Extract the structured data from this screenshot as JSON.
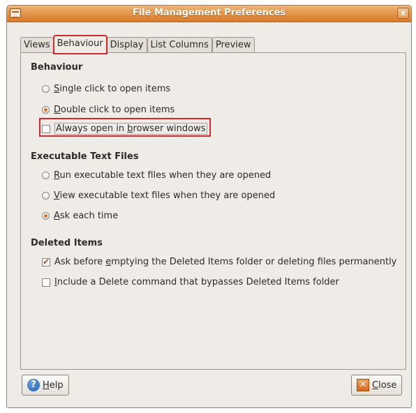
{
  "window": {
    "title": "File Management Preferences",
    "close_glyph": "x"
  },
  "tabs": [
    {
      "label": "Views"
    },
    {
      "label": "Behaviour"
    },
    {
      "label": "Display"
    },
    {
      "label": "List Columns"
    },
    {
      "label": "Preview"
    }
  ],
  "behaviour": {
    "section_title": "Behaviour",
    "single_click": {
      "mnemonic": "S",
      "rest": "ingle click to open items"
    },
    "double_click": {
      "mnemonic": "D",
      "rest": "ouble click to open items"
    },
    "always_browser": {
      "before": "Always open in ",
      "mnemonic": "b",
      "rest": "rowser windows"
    }
  },
  "executable": {
    "section_title": "Executable Text Files",
    "run": {
      "mnemonic": "R",
      "rest": "un executable text files when they are opened"
    },
    "view": {
      "mnemonic": "V",
      "rest": "iew executable text files when they are opened"
    },
    "ask": {
      "mnemonic": "A",
      "rest": "sk each time"
    }
  },
  "deleted": {
    "section_title": "Deleted Items",
    "ask_before": {
      "before": "Ask before ",
      "mnemonic": "e",
      "rest": "mptying the Deleted Items folder or deleting files permanently"
    },
    "include_delete": {
      "mnemonic": "I",
      "rest": "nclude a Delete command that bypasses Deleted Items folder"
    }
  },
  "buttons": {
    "help": {
      "mnemonic": "H",
      "rest": "elp",
      "icon": "help-icon"
    },
    "close": {
      "mnemonic": "C",
      "rest": "lose",
      "icon": "close-icon"
    }
  },
  "colors": {
    "titlebar": "#d97c2c",
    "highlight": "#d8262a"
  }
}
